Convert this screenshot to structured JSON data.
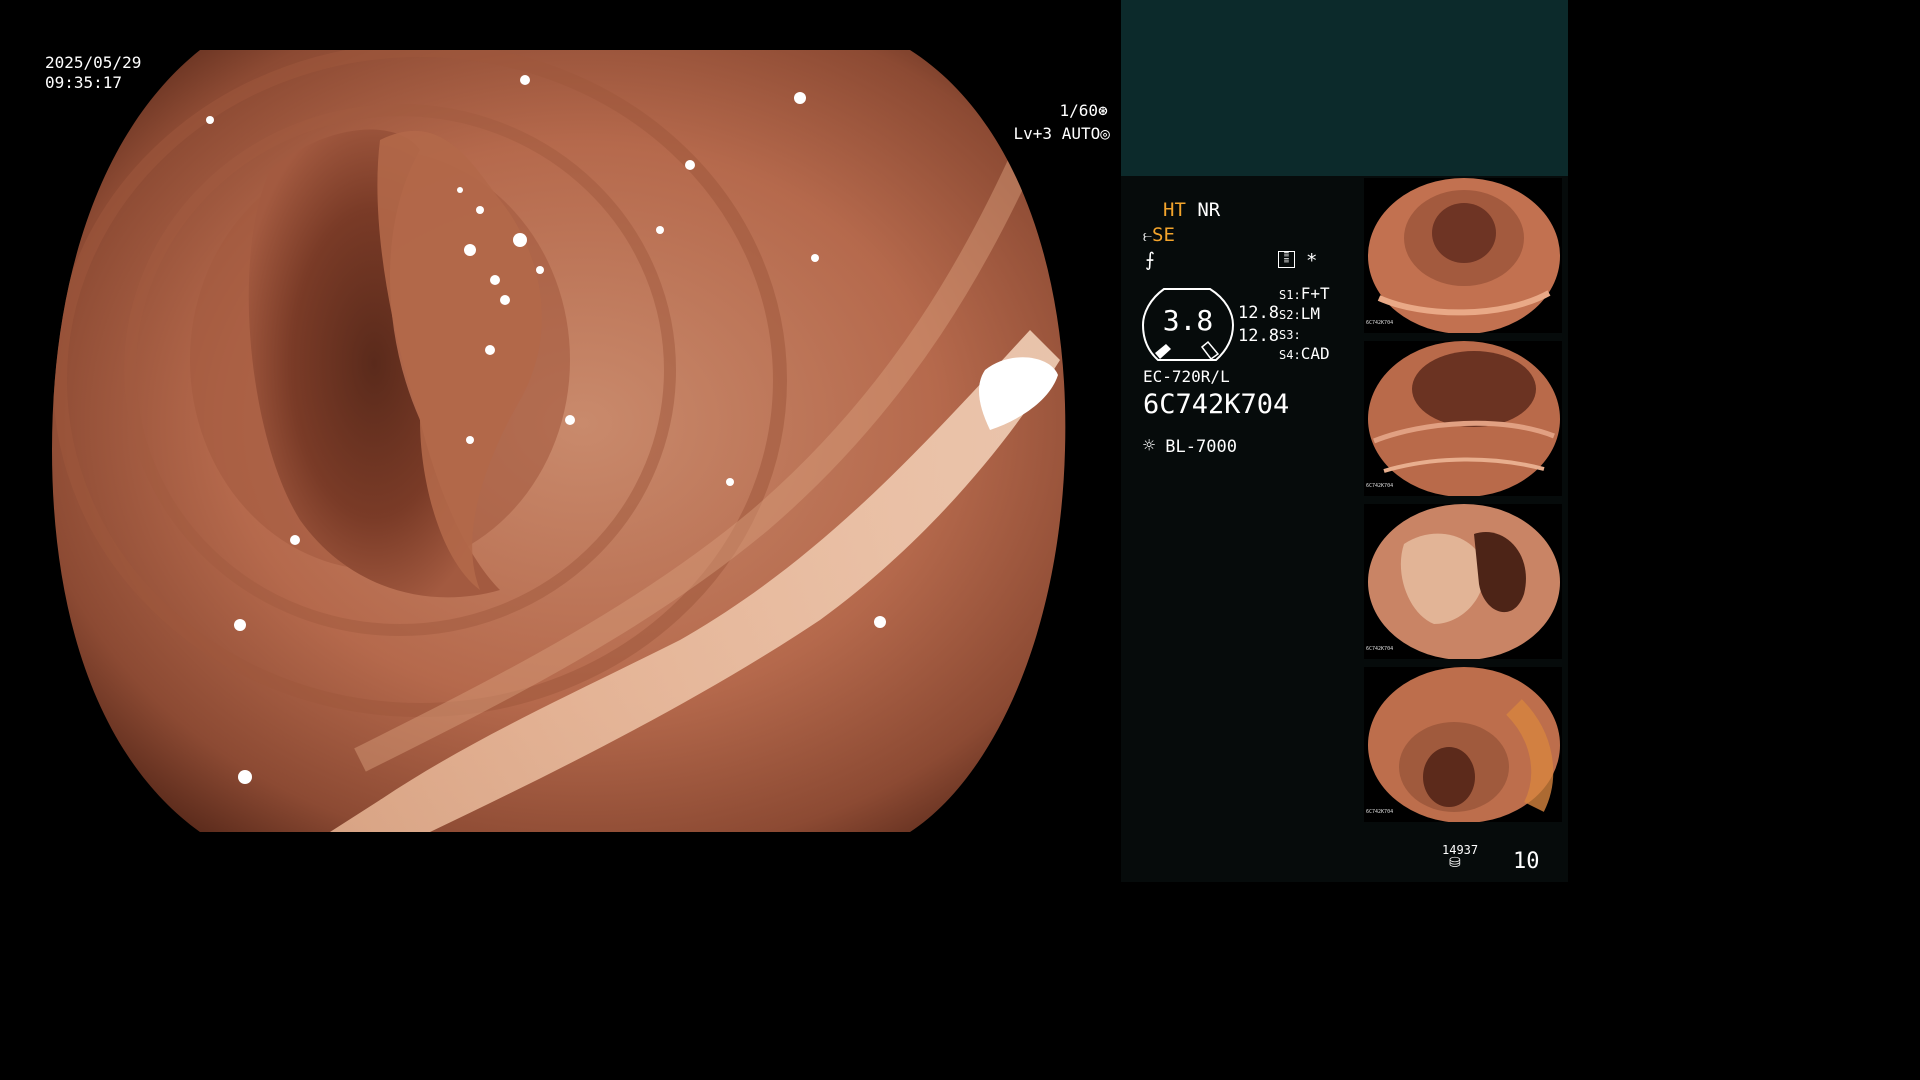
{
  "overlay": {
    "date": "2025/05/29",
    "time": "09:35:17",
    "shutter": "1/60",
    "level": "Lv+3",
    "iris_mode": "AUTO"
  },
  "panel": {
    "mode_ht": "HT",
    "mode_nr": "NR",
    "mode_se": "SE",
    "gauge_value": "3.8",
    "gauge_upper": "12.8",
    "gauge_lower": "12.8",
    "switches": [
      {
        "key": "S1",
        "value": "F+T"
      },
      {
        "key": "S2",
        "value": "LM"
      },
      {
        "key": "S3",
        "value": ""
      },
      {
        "key": "S4",
        "value": "CAD"
      }
    ],
    "scope_model": "EC-720R/L",
    "scope_serial": "6C742K704",
    "light_source": "BL-7000",
    "asterisk": "*",
    "image_count": "14937",
    "counter": "10"
  },
  "thumbnails": [
    {
      "id": "6C742K704"
    },
    {
      "id": "6C742K704"
    },
    {
      "id": "6C742K704"
    },
    {
      "id": "6C742K704"
    }
  ],
  "colors": {
    "panel_top": "#0c2a2b",
    "panel_bg": "#060b0b",
    "accent_orange": "#f3a42c",
    "tissue": "#b8684a"
  }
}
